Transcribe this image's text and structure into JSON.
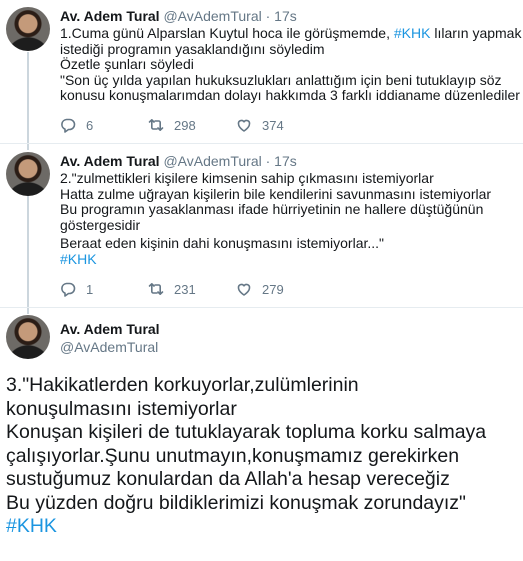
{
  "tweets": [
    {
      "name": "Av. Adem Tural",
      "handle": "@AvAdemTural",
      "dot": "·",
      "time": "17s",
      "lines": [
        {
          "pre": "1.Cuma günü Alparslan Kuytul hoca ile görüşmemde, ",
          "tag": "#KHK",
          "post": " lıların yapmak"
        },
        {
          "text": "istediği programın yasaklandığını söyledim"
        },
        {
          "text": "Özetle şunları söyledi"
        },
        {
          "text": "\"Son üç yılda yapılan hukuksuzlukları anlattığım için beni tutuklayıp söz"
        },
        {
          "text": "konusu konuşmalarımdan dolayı hakkımda 3 farklı iddianame düzenlediler"
        }
      ],
      "replies": "6",
      "retweets": "298",
      "likes": "374"
    },
    {
      "name": "Av. Adem Tural",
      "handle": "@AvAdemTural",
      "dot": "·",
      "time": "17s",
      "lines": [
        "2.\"zulmettikleri kişilere kimsenin sahip çıkmasını istemiyorlar",
        "Hatta zulme uğrayan kişilerin bile kendilerini savunmasını istemiyorlar",
        "Bu programın yasaklanması ifade hürriyetinin ne hallere düştüğünün",
        "göstergesidir",
        "Beraat eden kişinin dahi konuşmasını istemiyorlar...\""
      ],
      "hashtag": "#KHK",
      "replies": "1",
      "retweets": "231",
      "likes": "279"
    },
    {
      "name": "Av. Adem Tural",
      "handle": "@AvAdemTural",
      "lines": [
        "3.\"Hakikatlerden korkuyorlar,zulümlerinin",
        "konuşulmasını istemiyorlar",
        "Konuşan kişileri de tutuklayarak topluma korku salmaya",
        "çalışıyorlar.Şunu unutmayın,konuşmamız gerekirken",
        "sustuğumuz konulardan da Allah'a hesap vereceğiz",
        "Bu yüzden doğru bildiklerimizi konuşmak zorundayız\""
      ],
      "hashtag": "#KHK"
    }
  ],
  "icons": {
    "reply": "reply-icon",
    "retweet": "retweet-icon",
    "like": "heart-icon"
  },
  "colors": {
    "link": "#1b95e0",
    "secondary_text": "#657786",
    "separator": "#e6ecf0",
    "thread_line": "#ccd6dd"
  }
}
